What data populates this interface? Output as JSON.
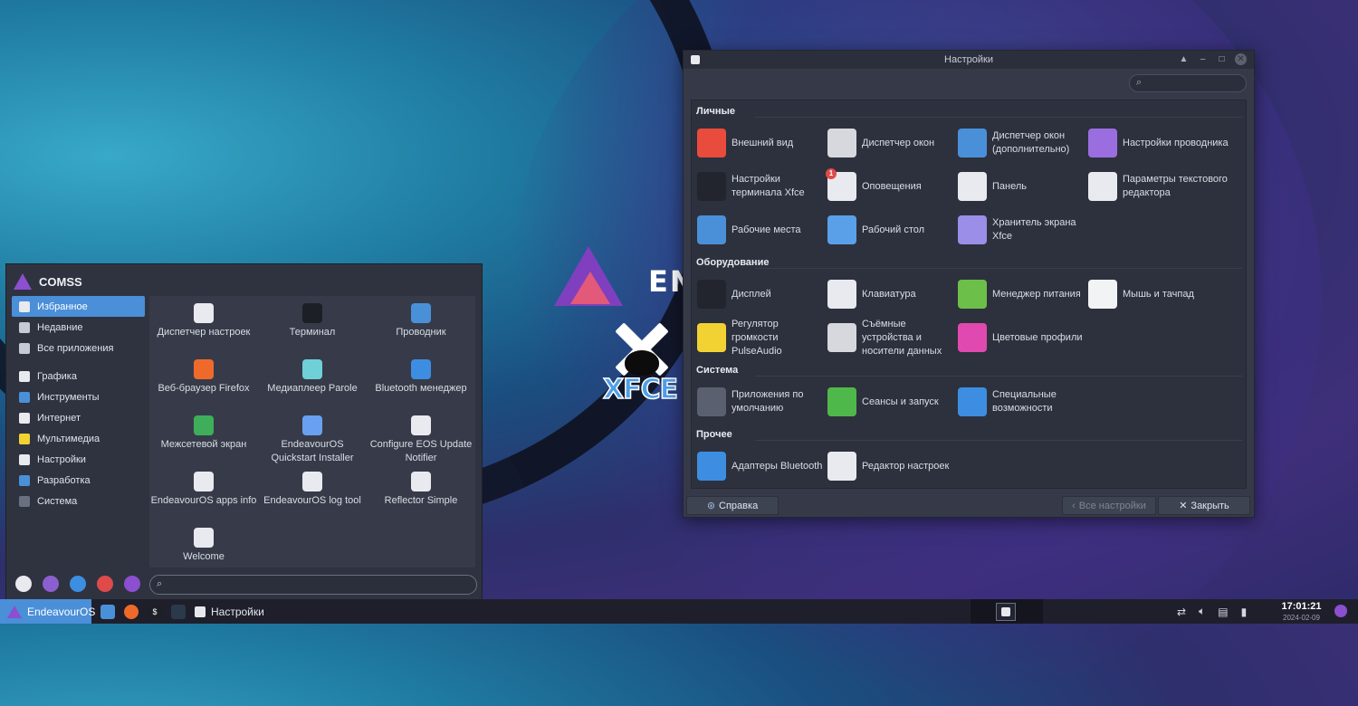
{
  "wallpaper": {
    "brand_text": "END",
    "xfce_text": "XFCE"
  },
  "settings_window": {
    "title": "Настройки",
    "search_placeholder": "",
    "categories": [
      {
        "name": "Личные",
        "items": [
          {
            "label": "Внешний вид",
            "icon": "appearance-icon",
            "color": "#e94b3c"
          },
          {
            "label": "Диспетчер окон",
            "icon": "window-manager-icon",
            "color": "#d6d8de"
          },
          {
            "label": "Диспетчер окон (дополнительно)",
            "icon": "window-manager-tweaks-icon",
            "color": "#4a90d9"
          },
          {
            "label": "Настройки проводника",
            "icon": "folder-icon",
            "color": "#9b6ee0"
          },
          {
            "label": "Настройки терминала Xfce",
            "icon": "terminal-icon",
            "color": "#22252d"
          },
          {
            "label": "Оповещения",
            "icon": "notifications-icon",
            "color": "#e8eaef",
            "badge": "1"
          },
          {
            "label": "Панель",
            "icon": "panel-icon",
            "color": "#e8eaef"
          },
          {
            "label": "Параметры текстового редактора",
            "icon": "text-editor-icon",
            "color": "#e8eaef"
          },
          {
            "label": "Рабочие места",
            "icon": "workspaces-icon",
            "color": "#4a90d9"
          },
          {
            "label": "Рабочий стол",
            "icon": "desktop-icon",
            "color": "#5aa0e8"
          },
          {
            "label": "Хранитель экрана Xfce",
            "icon": "screensaver-icon",
            "color": "#9b8ee8"
          }
        ]
      },
      {
        "name": "Оборудование",
        "items": [
          {
            "label": "Дисплей",
            "icon": "display-icon",
            "color": "#22252d"
          },
          {
            "label": "Клавиатура",
            "icon": "keyboard-icon",
            "color": "#e8eaef"
          },
          {
            "label": "Менеджер питания",
            "icon": "power-manager-icon",
            "color": "#6cc04a"
          },
          {
            "label": "Мышь и тачпад",
            "icon": "mouse-icon",
            "color": "#f2f3f5"
          },
          {
            "label": "Регулятор громкости PulseAudio",
            "icon": "volume-icon",
            "color": "#f2d233"
          },
          {
            "label": "Съёмные устройства и носители данных",
            "icon": "removable-media-icon",
            "color": "#d6d8de"
          },
          {
            "label": "Цветовые профили",
            "icon": "color-profiles-icon",
            "color": "#e04ab0"
          }
        ]
      },
      {
        "name": "Система",
        "items": [
          {
            "label": "Приложения по умолчанию",
            "icon": "default-apps-icon",
            "color": "#5b6070"
          },
          {
            "label": "Сеансы и запуск",
            "icon": "session-icon",
            "color": "#4fb84a"
          },
          {
            "label": "Специальные возможности",
            "icon": "accessibility-icon",
            "color": "#3d8ee0"
          }
        ]
      },
      {
        "name": "Прочее",
        "items": [
          {
            "label": "Адаптеры Bluetooth",
            "icon": "bluetooth-icon",
            "color": "#3d8ee0"
          },
          {
            "label": "Редактор настроек",
            "icon": "settings-editor-icon",
            "color": "#e8eaef"
          }
        ]
      }
    ],
    "footer": {
      "help": "Справка",
      "all_settings": "Все настройки",
      "close": "Закрыть"
    }
  },
  "menu": {
    "user": "COMSS",
    "categories": [
      {
        "label": "Избранное",
        "selected": true,
        "color": "#e8eaef"
      },
      {
        "label": "Недавние",
        "color": "#c5cad4"
      },
      {
        "label": "Все приложения",
        "color": "#c5cad4"
      },
      {
        "label": "Графика",
        "color": "#e8eaef"
      },
      {
        "label": "Инструменты",
        "color": "#4a90d9"
      },
      {
        "label": "Интернет",
        "color": "#e8eaef"
      },
      {
        "label": "Мультимедиа",
        "color": "#f2d233"
      },
      {
        "label": "Настройки",
        "color": "#e8eaef"
      },
      {
        "label": "Разработка",
        "color": "#4a90d9"
      },
      {
        "label": "Система",
        "color": "#6a7080"
      }
    ],
    "apps": [
      {
        "label": "Диспетчер настроек",
        "color": "#e8eaef"
      },
      {
        "label": "Терминал",
        "color": "#1c1f26"
      },
      {
        "label": "Проводник",
        "color": "#4a90d9"
      },
      {
        "label": "Веб-браузер Firefox",
        "color": "#ef6a2a"
      },
      {
        "label": "Медиаплеер Parole",
        "color": "#6fd0d8"
      },
      {
        "label": "Bluetooth менеджер",
        "color": "#3d8ee0"
      },
      {
        "label": "Межсетевой экран",
        "color": "#3fae5a"
      },
      {
        "label": "EndeavourOS Quickstart Installer",
        "color": "#6aa0f0"
      },
      {
        "label": "Configure EOS Update Notifier",
        "color": "#e8eaef"
      },
      {
        "label": "EndeavourOS apps info",
        "color": "#e8eaef"
      },
      {
        "label": "EndeavourOS log tool",
        "color": "#e8eaef"
      },
      {
        "label": "Reflector Simple",
        "color": "#e8eaef"
      },
      {
        "label": "Welcome",
        "color": "#e8eaef"
      }
    ],
    "search_placeholder": "",
    "bottom_actions": [
      {
        "name": "settings-manager-icon",
        "color": "#e8eaef"
      },
      {
        "name": "lock-icon",
        "color": "#8b5fd0"
      },
      {
        "name": "switch-user-icon",
        "color": "#3d8ee0"
      },
      {
        "name": "power-icon",
        "color": "#e04a4a"
      },
      {
        "name": "logout-icon",
        "color": "#8b4fd0"
      }
    ]
  },
  "taskbar": {
    "start_label": "EndeavourOS",
    "task_label": "Настройки",
    "time": "17:01:21",
    "date": "2024-02-09"
  },
  "accent": "#4a8fd8"
}
